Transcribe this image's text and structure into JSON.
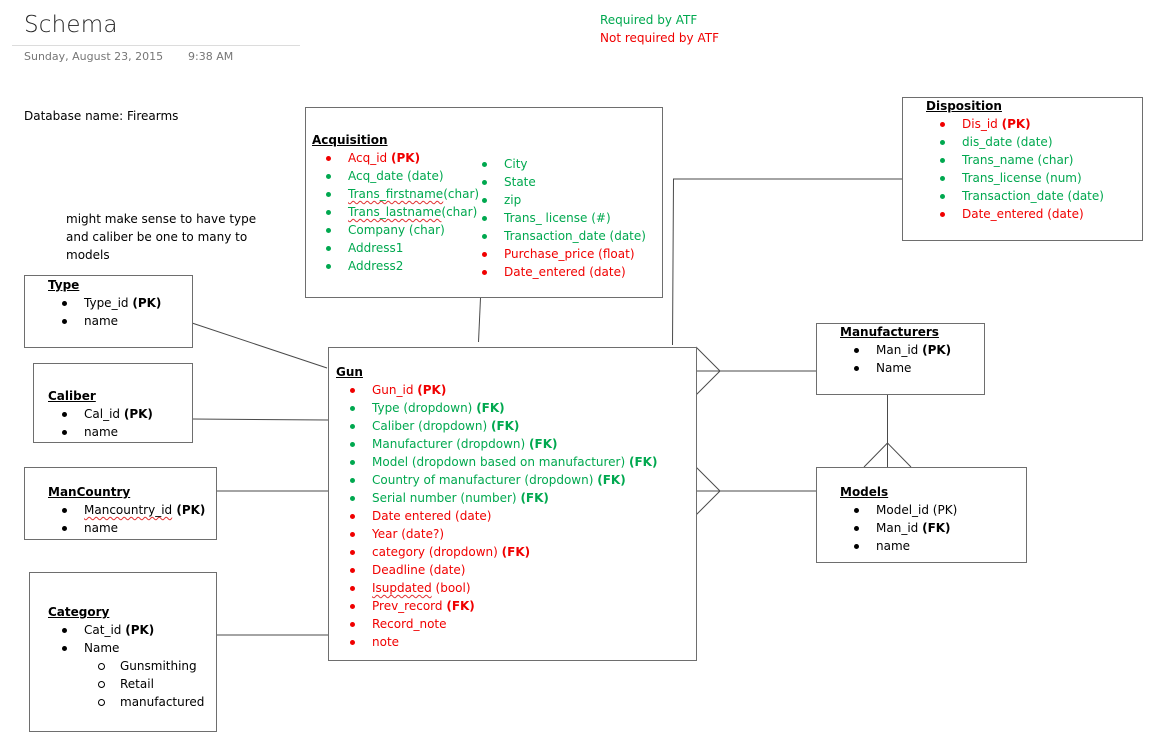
{
  "page": {
    "title": "Schema",
    "date": "Sunday, August 23, 2015",
    "time": "9:38 AM",
    "database_label": "Database name: Firearms",
    "note": [
      "might make sense to have type",
      "and caliber be one to many to",
      "models"
    ]
  },
  "legend": {
    "required": "Required by ATF",
    "not_required": "Not required by ATF",
    "required_color": "#00A84F",
    "not_required_color": "#F00000"
  },
  "entities": {
    "acquisition": {
      "title": "Acquisition",
      "col1": [
        {
          "text": "Acq_id ",
          "tag": "(PK)",
          "status": "not_required"
        },
        {
          "text": "Acq_date (date)",
          "status": "required"
        },
        {
          "text": "Trans_firstname",
          "suffix": "(char)",
          "status": "required"
        },
        {
          "text": "Trans_lastname",
          "suffix": "(char)",
          "status": "required"
        },
        {
          "text": "Company (char)",
          "status": "required"
        },
        {
          "text": "Address1",
          "status": "required"
        },
        {
          "text": "Address2",
          "status": "required"
        }
      ],
      "col2": [
        {
          "text": "City",
          "status": "required"
        },
        {
          "text": "State",
          "status": "required"
        },
        {
          "text": "zip",
          "status": "required"
        },
        {
          "text": "Trans_ license (#)",
          "status": "required"
        },
        {
          "text": "Transaction_date (date)",
          "status": "required"
        },
        {
          "text": "Purchase_price (float)",
          "status": "not_required"
        },
        {
          "text": "Date_entered (date)",
          "status": "not_required"
        }
      ]
    },
    "disposition": {
      "title": "Disposition",
      "fields": [
        {
          "text": "Dis_id ",
          "tag": "(PK)",
          "status": "not_required"
        },
        {
          "text": "dis_date (date)",
          "status": "required"
        },
        {
          "text": "Trans_name (char)",
          "status": "required"
        },
        {
          "text": "Trans_license (num)",
          "status": "required"
        },
        {
          "text": "Transaction_date (date)",
          "status": "required"
        },
        {
          "text": "Date_entered (date)",
          "status": "not_required"
        }
      ]
    },
    "type": {
      "title": "Type",
      "fields": [
        {
          "text": "Type_id ",
          "tag": "(PK)"
        },
        {
          "text": "name"
        }
      ]
    },
    "caliber": {
      "title": "Caliber",
      "fields": [
        {
          "text": "Cal_id ",
          "tag": "(PK)"
        },
        {
          "text": "name"
        }
      ]
    },
    "mancountry": {
      "title": "ManCountry",
      "fields": [
        {
          "text": "Mancountry_id",
          "tag": " (PK)"
        },
        {
          "text": "name"
        }
      ]
    },
    "category": {
      "title": "Category",
      "fields": [
        {
          "text": "Cat_id ",
          "tag": "(PK)"
        },
        {
          "text": "Name"
        }
      ],
      "name_values": [
        "Gunsmithing",
        "Retail",
        "manufactured"
      ]
    },
    "gun": {
      "title": "Gun",
      "fields": [
        {
          "text": "Gun_id ",
          "tag": "(PK)",
          "status": "not_required"
        },
        {
          "text": "Type (dropdown) ",
          "tag": "(FK)",
          "status": "required"
        },
        {
          "text": "Caliber (dropdown) ",
          "tag": "(FK)",
          "status": "required"
        },
        {
          "text": "Manufacturer (dropdown) ",
          "tag": "(FK)",
          "status": "required"
        },
        {
          "text": "Model (dropdown based on manufacturer) ",
          "tag": "(FK)",
          "status": "required"
        },
        {
          "text": "Country of manufacturer (dropdown) ",
          "tag": "(FK)",
          "status": "required"
        },
        {
          "text": "Serial number (number) ",
          "tag": "(FK)",
          "status": "required"
        },
        {
          "text": "Date entered (date)",
          "status": "not_required"
        },
        {
          "text": "Year (date?)",
          "status": "not_required"
        },
        {
          "text": "category (dropdown) ",
          "tag": "(FK)",
          "status": "not_required"
        },
        {
          "text": "Deadline (date)",
          "status": "not_required"
        },
        {
          "text": "Isupdated",
          "suffix": " (bool)",
          "status": "not_required"
        },
        {
          "text": "Prev_record ",
          "tag": "(FK)",
          "status": "not_required"
        },
        {
          "text": "Record_note",
          "status": "not_required"
        },
        {
          "text": "note",
          "status": "not_required"
        }
      ]
    },
    "manufacturers": {
      "title": "Manufacturers",
      "fields": [
        {
          "text": "Man_id ",
          "tag": "(PK)"
        },
        {
          "text": "Name"
        }
      ]
    },
    "models": {
      "title": "Models",
      "fields": [
        {
          "text": "Model_id (PK)"
        },
        {
          "text": "Man_id ",
          "tag": "(FK)"
        },
        {
          "text": "name"
        }
      ]
    }
  }
}
